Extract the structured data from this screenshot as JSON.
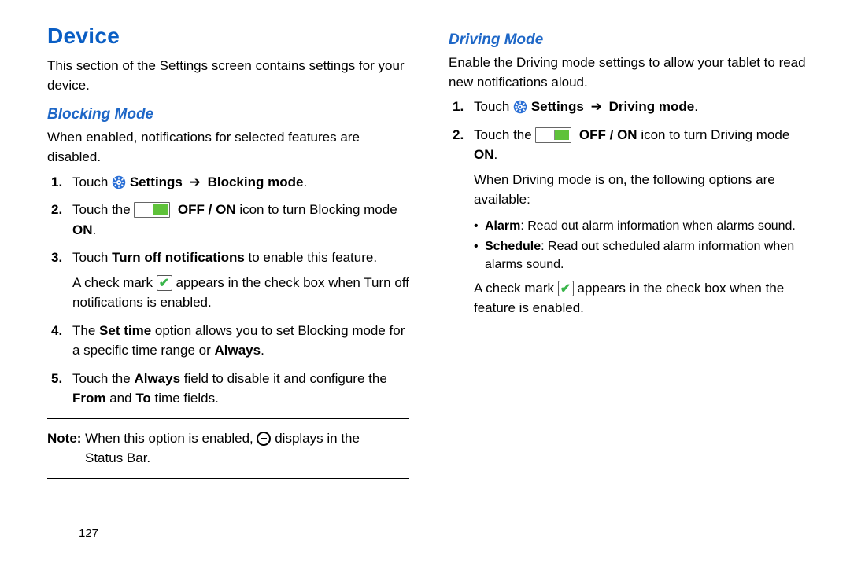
{
  "left": {
    "h1": "Device",
    "intro": "This section of the Settings screen contains settings for your device.",
    "blocking": {
      "h2": "Blocking Mode",
      "intro": "When enabled, notifications for selected features are disabled.",
      "step1_a": "Touch ",
      "step1_b": "Settings",
      "step1_arrow": " ➔ ",
      "step1_c": "Blocking mode",
      "step1_d": ".",
      "step2_a": "Touch the ",
      "step2_b": "OFF / ON",
      "step2_c": " icon to turn Blocking mode ",
      "step2_d": "ON",
      "step2_e": ".",
      "step3_a": "Touch ",
      "step3_b": "Turn off notifications",
      "step3_c": " to enable this feature.",
      "step3_sub_a": "A check mark ",
      "step3_sub_b": " appears in the check box when Turn off notifications is enabled.",
      "step4_a": "The ",
      "step4_b": "Set time",
      "step4_c": " option allows you to set Blocking mode for a specific time range or ",
      "step4_d": "Always",
      "step4_e": ".",
      "step5_a": "Touch the ",
      "step5_b": "Always",
      "step5_c": " field to disable it and configure the ",
      "step5_d": "From",
      "step5_e": " and ",
      "step5_f": "To",
      "step5_g": " time fields.",
      "note_label": "Note:",
      "note_a": " When this option is enabled, ",
      "note_b": " displays in the ",
      "note_c": "Status Bar."
    }
  },
  "right": {
    "driving": {
      "h2": "Driving Mode",
      "intro": "Enable the Driving mode settings to allow your tablet to read new notifications aloud.",
      "step1_a": "Touch ",
      "step1_b": "Settings",
      "step1_arrow": " ➔ ",
      "step1_c": "Driving mode",
      "step1_d": ".",
      "step2_a": "Touch the ",
      "step2_b": "OFF / ON",
      "step2_c": " icon to turn Driving mode ",
      "step2_d": "ON",
      "step2_e": ".",
      "sub1": "When Driving mode is on, the following options are available:",
      "bul1_a": "Alarm",
      "bul1_b": ": Read out alarm information when alarms sound.",
      "bul2_a": "Schedule",
      "bul2_b": ": Read out scheduled alarm information when alarms sound.",
      "check_a": "A check mark ",
      "check_b": " appears in the check box when the feature is enabled."
    }
  },
  "page_number": "127"
}
